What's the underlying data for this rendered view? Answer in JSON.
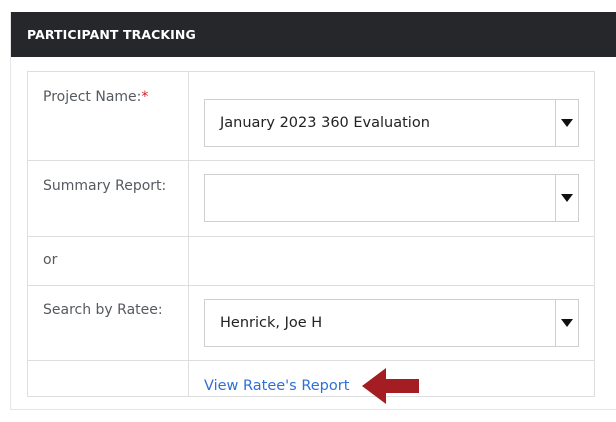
{
  "panel": {
    "title": "PARTICIPANT TRACKING"
  },
  "form": {
    "project": {
      "label": "Project Name:",
      "required_mark": "*",
      "selected": "January 2023 360 Evaluation"
    },
    "summary": {
      "label": "Summary Report:",
      "selected": ""
    },
    "or_label": "or",
    "ratee": {
      "label": "Search by Ratee:",
      "selected": "Henrick, Joe H"
    },
    "view_report_link": "View Ratee's Report"
  },
  "colors": {
    "header_bg": "#25272a",
    "link": "#2f6fd6",
    "arrow": "#a31d22",
    "required": "#d11f1f"
  },
  "icons": {
    "dropdown": "caret-down-icon",
    "pointer": "arrow-left-icon"
  }
}
